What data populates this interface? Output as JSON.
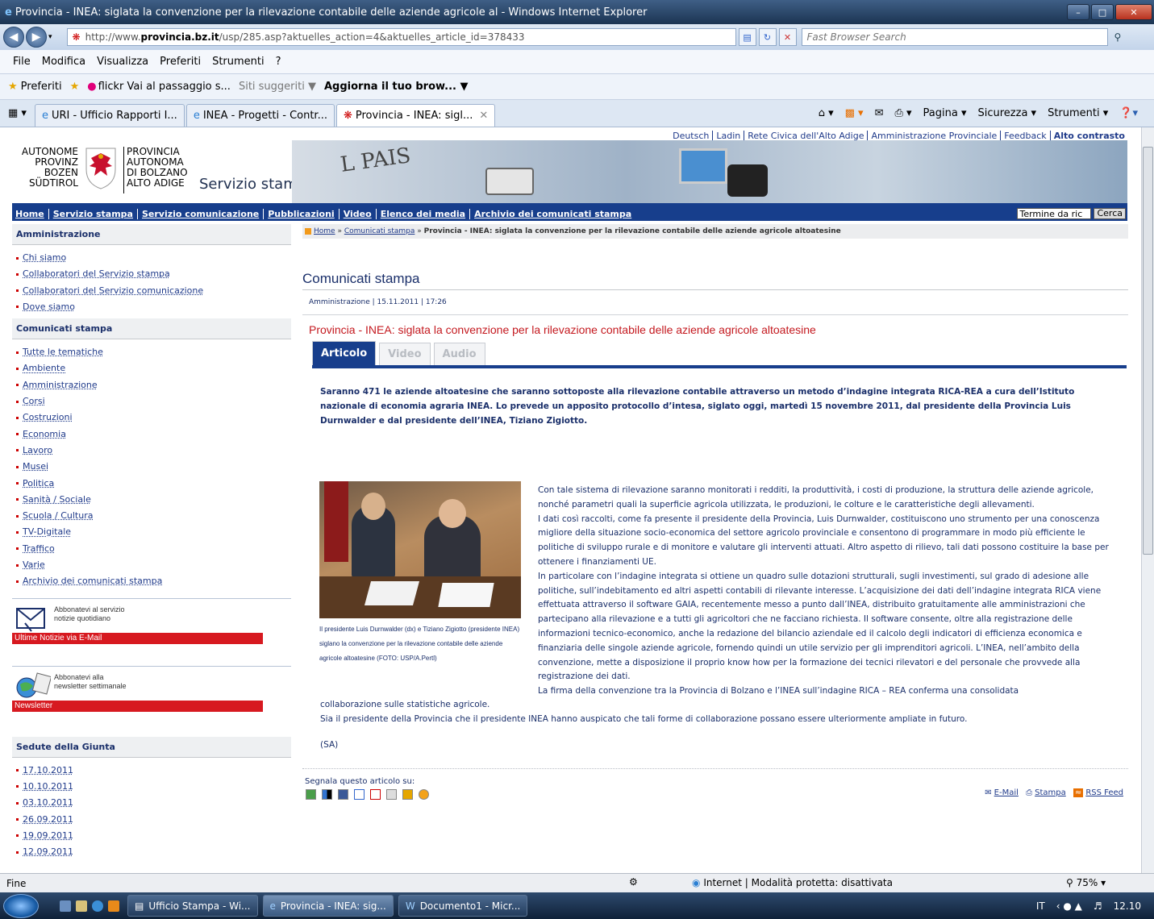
{
  "browser": {
    "title": "Provincia - INEA: siglata la convenzione per la rilevazione contabile delle aziende agricole al - Windows Internet Explorer",
    "url_prefix": "http://www.",
    "url_domain": "provincia.bz.it",
    "url_rest": "/usp/285.asp?aktuelles_action=4&aktuelles_article_id=378433",
    "search_placeholder": "Fast Browser Search",
    "menu": [
      "File",
      "Modifica",
      "Visualizza",
      "Preferiti",
      "Strumenti",
      "?"
    ],
    "favorites": {
      "label": "Preferiti",
      "items": [
        "flickr Vai al passaggio s...",
        "Siti suggeriti ▼",
        "Aggiorna il tuo brow... ▼"
      ]
    },
    "tabs": [
      "URI - Ufficio Rapporti I...",
      "INEA - Progetti - Contr...",
      "Provincia - INEA: sigl..."
    ],
    "tools": [
      "Pagina ▾",
      "Sicurezza ▾",
      "Strumenti ▾"
    ],
    "status": "Fine",
    "zone": "Internet | Modalità protetta: disattivata",
    "zoom": "75%"
  },
  "taskbar": {
    "items": [
      "Ufficio Stampa - Wi...",
      "Provincia - INEA: sig...",
      "Documento1 - Micr..."
    ],
    "lang": "IT",
    "clock": "12.10"
  },
  "site": {
    "toplinks": [
      "Deutsch",
      "Ladin",
      "Rete Civica dell'Alto Adige",
      "Amministrazione Provinciale",
      "Feedback",
      "Alto contrasto"
    ],
    "logo_left": "AUTONOME\nPROVINZ\nBOZEN\nSÜDTIROL",
    "logo_right": "PROVINCIA\nAUTONOMA\nDI BOLZANO\nALTO ADIGE",
    "section": "Servizio stampa",
    "nav": [
      "Home",
      "Servizio stampa",
      "Servizio comunicazione",
      "Pubblicazioni",
      "Video",
      "Elenco dei media",
      "Archivio dei comunicati stampa"
    ],
    "search_value": "Termine da ric",
    "search_button": "Cerca"
  },
  "sidebar": {
    "admin_title": "Amministrazione",
    "admin_items": [
      "Chi siamo",
      "Collaboratori del Servizio stampa",
      "Collaboratori del Servizio comunicazione",
      "Dove siamo"
    ],
    "press_title": "Comunicati stampa",
    "press_items": [
      "Tutte le tematiche",
      "Ambiente",
      "Amministrazione",
      "Corsi",
      "Costruzioni",
      "Economia",
      "Lavoro",
      "Musei",
      "Politica",
      "Sanità / Sociale",
      "Scuola / Cultura",
      "TV-Digitale",
      "Traffico",
      "Varie",
      "Archivio dei comunicati stampa"
    ],
    "promo1_text": "Abbonatevi al servizio\nnotizie quotidiano",
    "promo1_bar": "Ultime Notizie via E-Mail",
    "promo2_text": "Abbonatevi alla\nnewsletter settimanale",
    "promo2_bar": "Newsletter",
    "giunta_title": "Sedute della Giunta",
    "giunta_items": [
      "17.10.2011",
      "10.10.2011",
      "03.10.2011",
      "26.09.2011",
      "19.09.2011",
      "12.09.2011"
    ]
  },
  "article": {
    "crumb_home": "Home",
    "crumb_section": "Comunicati stampa",
    "crumb_current": "Provincia - INEA: siglata la convenzione per la rilevazione contabile delle aziende agricole altoatesine",
    "page_title": "Comunicati stampa",
    "meta": "Amministrazione | 15.11.2011 | 17:26",
    "headline": "Provincia - INEA: siglata la convenzione per la rilevazione contabile delle aziende agricole altoatesine",
    "tabs": [
      "Articolo",
      "Video",
      "Audio"
    ],
    "lead": "Saranno 471 le aziende altoatesine che saranno sottoposte alla rilevazione contabile attraverso un metodo d’indagine integrata RICA-REA a cura dell’Istituto nazionale di economia agraria INEA. Lo prevede un apposito protocollo d’intesa, siglato oggi, martedì 15 novembre 2011, dal presidente della Provincia Luis Durnwalder e dal presidente dell’INEA, Tiziano Zigiotto.",
    "caption": "Il presidente Luis Durnwalder (dx) e Tiziano Zigiotto (presidente INEA) siglano la convenzione per la rilevazione contabile delle aziende agricole altoatesine (FOTO: USP/A.Pertl)",
    "body1": "Con tale sistema di rilevazione saranno monitorati i redditi, la produttività, i costi di produzione, la struttura delle aziende agricole, nonché parametri quali la superficie agricola utilizzata, le produzioni, le colture e le caratteristiche degli allevamenti.\nI dati così raccolti, come fa presente il presidente della Provincia, Luis Durnwalder, costituiscono uno strumento per una conoscenza migliore della situazione socio-economica del settore agricolo provinciale e consentono di programmare in modo più efficiente le politiche di sviluppo rurale e di monitore e valutare gli interventi attuati. Altro aspetto di rilievo, tali dati possono costituire la base per ottenere i finanziamenti UE.\nIn particolare con l’indagine integrata si ottiene un quadro sulle dotazioni strutturali, sugli investimenti, sul grado di adesione alle politiche, sull’indebitamento ed altri aspetti contabili di rilevante interesse. L’acquisizione dei dati dell’indagine integrata RICA viene effettuata attraverso il software GAIA, recentemente messo a punto dall’INEA, distribuito gratuitamente alle amministrazioni che partecipano alla rilevazione e a tutti gli agricoltori che ne facciano richiesta. Il software consente, oltre alla registrazione delle informazioni tecnico-economico, anche la redazione del bilancio aziendale ed il calcolo degli indicatori di efficienza economica e finanziaria delle singole aziende agricole, fornendo quindi un utile servizio per gli imprenditori agricoli. L’INEA, nell’ambito della convenzione, mette a disposizione il proprio know how per la formazione dei tecnici rilevatori e del personale che provvede alla registrazione dei dati.\nLa firma della convenzione tra la Provincia di Bolzano e l’INEA sull’indagine RICA – REA conferma una consolidata",
    "body2": "collaborazione sulle statistiche agricole.\nSia il presidente della Provincia che il presidente INEA hanno auspicato che tali forme di collaborazione possano essere ulteriormente ampliate in futuro.",
    "signature": "(SA)",
    "share_label": "Segnala questo articolo su:",
    "email": "E-Mail",
    "print": "Stampa",
    "rss": "RSS Feed"
  }
}
